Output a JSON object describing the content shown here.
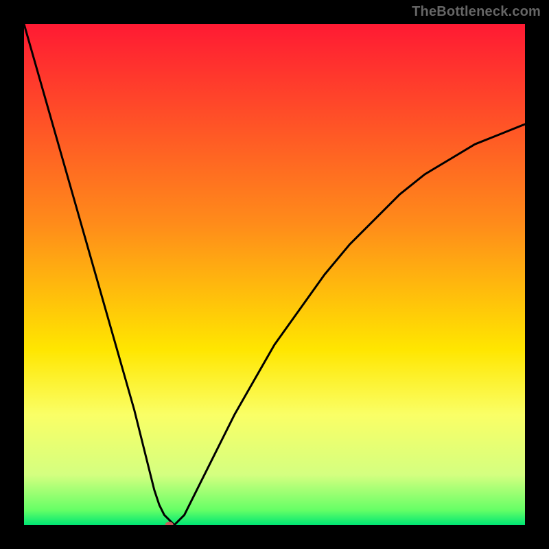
{
  "watermark": "TheBottleneck.com",
  "chart_data": {
    "type": "line",
    "title": "",
    "xlabel": "",
    "ylabel": "",
    "xlim": [
      0,
      100
    ],
    "ylim": [
      0,
      100
    ],
    "gradient_stops": [
      {
        "offset": 0,
        "color": "#ff1a33"
      },
      {
        "offset": 0.4,
        "color": "#ff8c1a"
      },
      {
        "offset": 0.65,
        "color": "#ffe600"
      },
      {
        "offset": 0.78,
        "color": "#faff66"
      },
      {
        "offset": 0.9,
        "color": "#d4ff80"
      },
      {
        "offset": 0.97,
        "color": "#66ff66"
      },
      {
        "offset": 1.0,
        "color": "#00e673"
      }
    ],
    "series": [
      {
        "name": "bottleneck-curve",
        "x": [
          0,
          2,
          4,
          6,
          8,
          10,
          12,
          14,
          16,
          18,
          20,
          22,
          24,
          25,
          26,
          27,
          28,
          29,
          30,
          31,
          32,
          33,
          35,
          38,
          42,
          46,
          50,
          55,
          60,
          65,
          70,
          75,
          80,
          85,
          90,
          95,
          100
        ],
        "y": [
          100,
          93,
          86,
          79,
          72,
          65,
          58,
          51,
          44,
          37,
          30,
          23,
          15,
          11,
          7,
          4,
          2,
          1,
          0,
          1,
          2,
          4,
          8,
          14,
          22,
          29,
          36,
          43,
          50,
          56,
          61,
          66,
          70,
          73,
          76,
          78,
          80
        ]
      }
    ],
    "marker": {
      "x": 29,
      "y": 0,
      "color": "#c75c5c",
      "r": 6
    }
  }
}
